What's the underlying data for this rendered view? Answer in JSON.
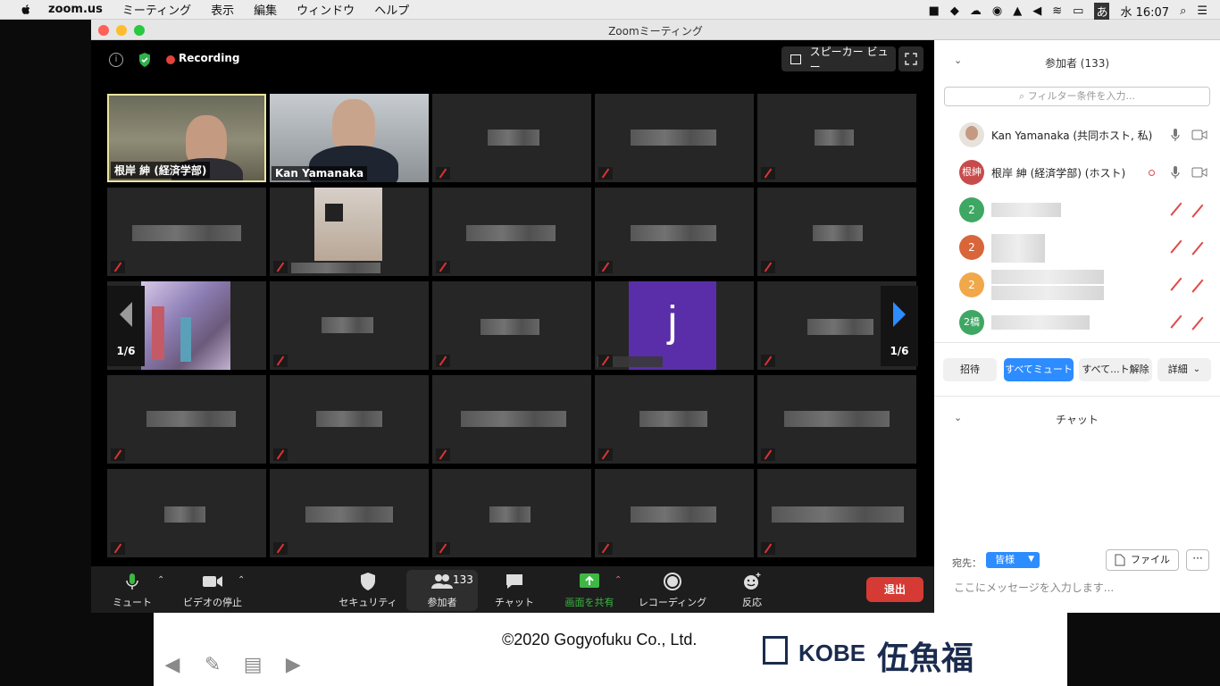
{
  "menubar": {
    "app": "zoom.us",
    "items": [
      "ミーティング",
      "表示",
      "編集",
      "ウィンドウ",
      "ヘルプ"
    ],
    "ime": "あ",
    "clock": "水 16:07"
  },
  "window": {
    "title": "Zoomミーティング"
  },
  "video": {
    "recording_label": "Recording",
    "speaker_view_label": "スピーカー ビュー",
    "page_left": "1/6",
    "page_right": "1/6",
    "tile_names": {
      "host": "根岸 紳 (経済学部)",
      "cohost": "Kan Yamanaka",
      "initial": "j"
    }
  },
  "toolbar": {
    "mute": "ミュート",
    "video_stop": "ビデオの停止",
    "security": "セキュリティ",
    "participants": "参加者",
    "participants_count": "133",
    "chat": "チャット",
    "share": "画面を共有",
    "recording": "レコーディング",
    "reactions": "反応",
    "leave": "退出"
  },
  "panel": {
    "title": "参加者 (133)",
    "filter_placeholder": "フィルター条件を入力...",
    "participants": [
      {
        "name": "Kan Yamanaka (共同ホスト, 私)"
      },
      {
        "name": "根岸 紳 (経済学部) (ホスト)",
        "avatar": "根紳"
      },
      {
        "avatar": "2"
      },
      {
        "avatar": "2"
      },
      {
        "avatar": "2"
      },
      {
        "avatar": "2橋"
      }
    ],
    "buttons": {
      "invite": "招待",
      "mute_all": "すべてミュート",
      "unmute_all": "すべて...ト解除",
      "more": "詳細"
    },
    "chat_title": "チャット",
    "chat_to_label": "宛先：",
    "chat_to_value": "皆様",
    "file_label": "ファイル",
    "more_label": "···",
    "message_placeholder": "ここにメッセージを入力します..."
  },
  "slide": {
    "copyright": "©2020 Gogyofuku Co., Ltd.",
    "logo_text": "KOBE",
    "logo_kanji": "伍魚福"
  },
  "colors": {
    "accent_blue": "#2d8cff",
    "leave_red": "#d53b34",
    "share_green": "#3cb843"
  }
}
